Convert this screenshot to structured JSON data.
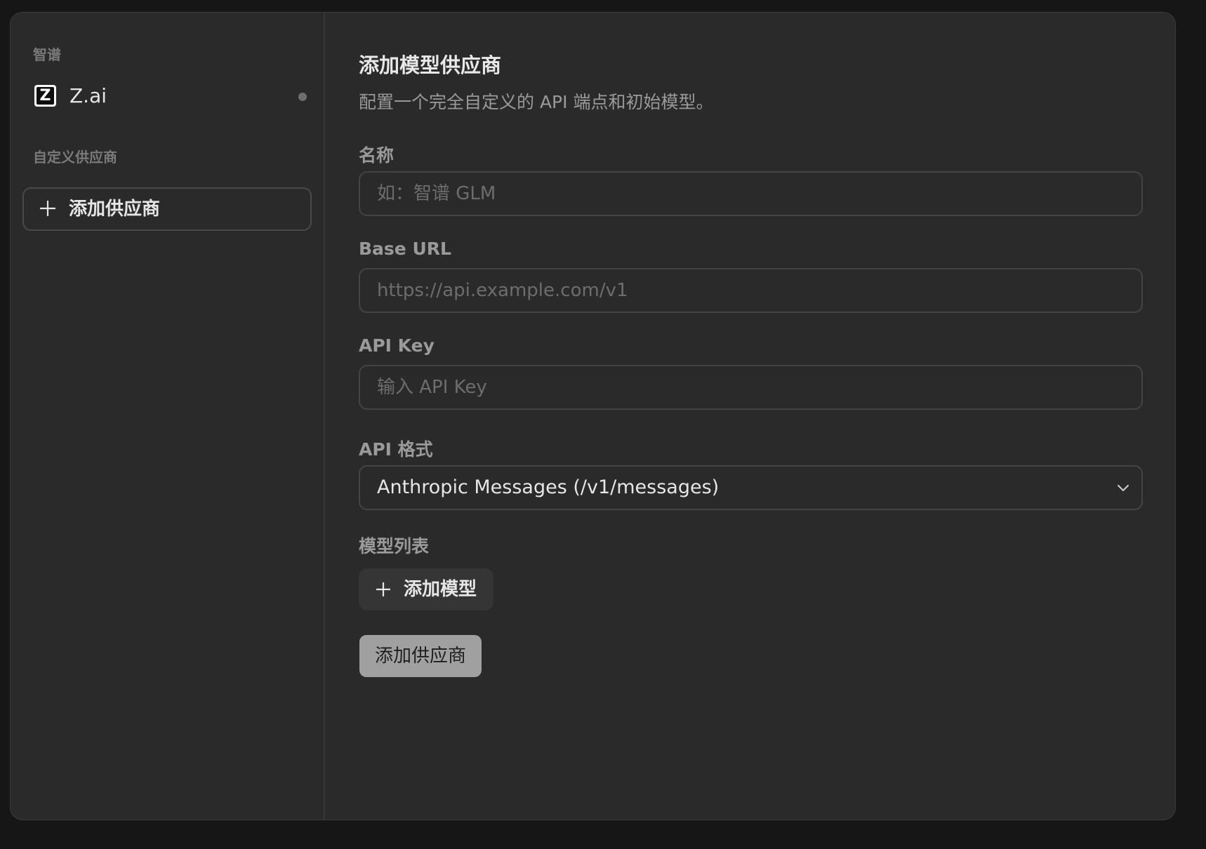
{
  "sidebar": {
    "zhipu_section_title": "智谱",
    "provider": {
      "name": "Z.ai",
      "logo_letter": "Z"
    },
    "custom_section_title": "自定义供应商",
    "add_provider_label": "添加供应商"
  },
  "form": {
    "title": "添加模型供应商",
    "subtitle": "配置一个完全自定义的 API 端点和初始模型。",
    "name": {
      "label": "名称",
      "placeholder": "如：智谱 GLM"
    },
    "base_url": {
      "label": "Base URL",
      "placeholder": "https://api.example.com/v1"
    },
    "api_key": {
      "label": "API Key",
      "placeholder": "输入 API Key"
    },
    "api_format": {
      "label": "API 格式",
      "selected": "Anthropic Messages (/v1/messages)"
    },
    "models": {
      "label": "模型列表",
      "add_model_label": "添加模型"
    },
    "submit_label": "添加供应商"
  },
  "colors": {
    "background": "#161616",
    "panel": "#2a2a2a",
    "text_primary": "#e6e6e6",
    "text_muted": "#9a9a9a",
    "submit_button": "#a0a0a0"
  },
  "icons": {
    "plus": "plus-icon",
    "chevron": "chevron-down-icon",
    "status": "status-dot"
  }
}
